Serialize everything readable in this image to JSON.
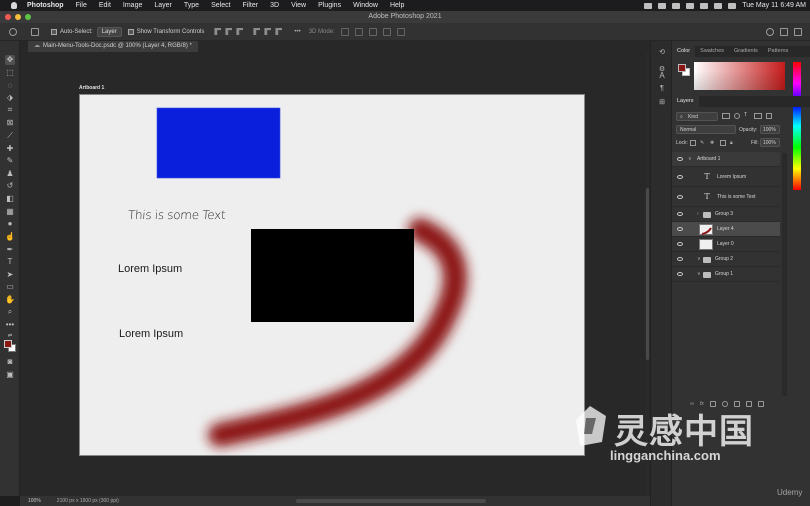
{
  "menubar": {
    "app": "Photoshop",
    "items": [
      "File",
      "Edit",
      "Image",
      "Layer",
      "Type",
      "Select",
      "Filter",
      "3D",
      "View",
      "Plugins",
      "Window",
      "Help"
    ],
    "datetime": "Tue May 11  6:49 AM"
  },
  "window": {
    "title": "Adobe Photoshop 2021"
  },
  "options": {
    "auto_select_label": "Auto-Select:",
    "auto_select_value": "Layer",
    "transform_label": "Show Transform Controls",
    "mode_3d": "3D Mode:"
  },
  "document": {
    "tab_label": "Main-Menu-Tools-Doc.psdc @ 100% (Layer 4, RGB/8) *",
    "artboard_name": "Artboard 1",
    "canvas_texts": {
      "handwritten": "This is some Text",
      "lorem1": "Lorem Ipsum",
      "lorem2": "Lorem Ipsum"
    },
    "colors": {
      "blue_rect": "#0a1fdc",
      "black_rect": "#000000",
      "stroke": "#8c1414"
    }
  },
  "statusbar": {
    "zoom": "100%",
    "doc_size": "2100 px x 1500 px (300 ppi)"
  },
  "panels": {
    "color_tabs": [
      "Color",
      "Swatches",
      "Gradients",
      "Patterns"
    ],
    "layers_tab": "Layers",
    "filter_kind": "Kind",
    "blend_mode": "Normal",
    "opacity_label": "Opacity:",
    "opacity_value": "100%",
    "lock_label": "Lock:",
    "fill_label": "Fill:",
    "fill_value": "100%",
    "foreground_color": "#8b1414",
    "layers": [
      {
        "name": "Artboard 1",
        "kind": "artboard"
      },
      {
        "name": "Lorem Ipsum",
        "kind": "text"
      },
      {
        "name": "This is some Text",
        "kind": "text"
      },
      {
        "name": "Group 3",
        "kind": "group"
      },
      {
        "name": "Layer 4",
        "kind": "pixel",
        "selected": true
      },
      {
        "name": "Layer 0",
        "kind": "pixel"
      },
      {
        "name": "Group 2",
        "kind": "group"
      },
      {
        "name": "Group 1",
        "kind": "group"
      }
    ]
  },
  "watermark": {
    "cn": "灵感中国",
    "en": "lingganchina.com",
    "udemy": "Udemy"
  }
}
